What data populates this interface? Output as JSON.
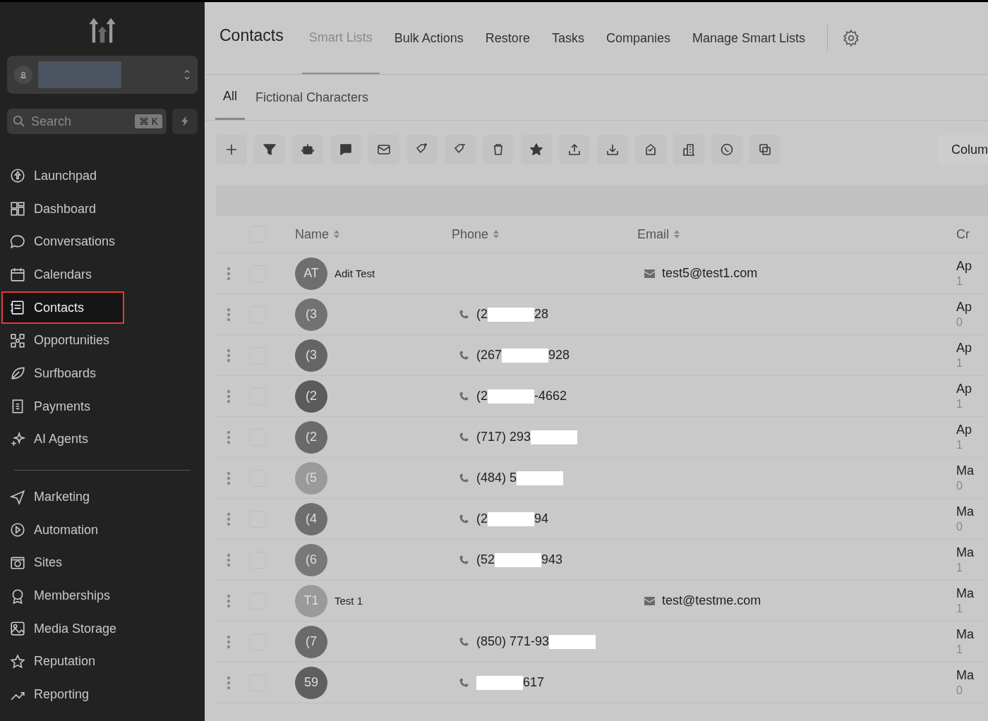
{
  "sidebar": {
    "search": {
      "placeholder": "Search",
      "shortcut": "⌘ K"
    },
    "items": [
      {
        "label": "Launchpad",
        "selected": false
      },
      {
        "label": "Dashboard",
        "selected": false
      },
      {
        "label": "Conversations",
        "selected": false
      },
      {
        "label": "Calendars",
        "selected": false
      },
      {
        "label": "Contacts",
        "selected": true
      },
      {
        "label": "Opportunities",
        "selected": false
      },
      {
        "label": "Surfboards",
        "selected": false
      },
      {
        "label": "Payments",
        "selected": false
      },
      {
        "label": "AI Agents",
        "selected": false
      }
    ],
    "items_2": [
      {
        "label": "Marketing",
        "selected": false
      },
      {
        "label": "Automation",
        "selected": false
      },
      {
        "label": "Sites",
        "selected": false
      },
      {
        "label": "Memberships",
        "selected": false
      },
      {
        "label": "Media Storage",
        "selected": false
      },
      {
        "label": "Reputation",
        "selected": false
      },
      {
        "label": "Reporting",
        "selected": false
      }
    ]
  },
  "header": {
    "title": "Contacts",
    "tabs": [
      {
        "label": "Smart Lists",
        "selected": true
      },
      {
        "label": "Bulk Actions",
        "selected": false
      },
      {
        "label": "Restore",
        "selected": false
      },
      {
        "label": "Tasks",
        "selected": false
      },
      {
        "label": "Companies",
        "selected": false
      },
      {
        "label": "Manage Smart Lists",
        "selected": false
      }
    ]
  },
  "list_tabs": [
    {
      "label": "All",
      "selected": true
    },
    {
      "label": "Fictional Characters",
      "selected": false
    }
  ],
  "columns_button": "Colum",
  "table": {
    "columns": [
      "Name",
      "Phone",
      "Email",
      "Cr"
    ],
    "select_all_checked": false,
    "rows": [
      {
        "initials": "AT",
        "color": "#6e6e6e",
        "name": "Adit Test",
        "phone_start": "",
        "phone_end": "",
        "email": "test5@test1.com",
        "created": "Ap",
        "created_2": "1",
        "checked": false
      },
      {
        "initials": "(3",
        "color": "#727272",
        "name": "",
        "phone_start": "(2",
        "phone_end": "28",
        "email": "",
        "created": "Ap",
        "created_2": "0",
        "checked": false
      },
      {
        "initials": "(3",
        "color": "#656565",
        "name": "",
        "phone_start": "(267",
        "phone_end": "928",
        "email": "",
        "created": "Ap",
        "created_2": "1",
        "checked": false
      },
      {
        "initials": "(2",
        "color": "#5b5b5b",
        "name": "",
        "phone_start": "(2",
        "phone_end": "-4662",
        "email": "",
        "created": "Ap",
        "created_2": "1",
        "checked": false
      },
      {
        "initials": "(2",
        "color": "#6a6a6a",
        "name": "",
        "phone_start": "(717) 293",
        "phone_end": "",
        "email": "",
        "created": "Ap",
        "created_2": "1",
        "checked": false
      },
      {
        "initials": "(5",
        "color": "#9a9a9a",
        "name": "",
        "phone_start": "(484) 5",
        "phone_end": "",
        "email": "",
        "created": "Ma",
        "created_2": "0",
        "checked": false
      },
      {
        "initials": "(4",
        "color": "#6e6e6e",
        "name": "",
        "phone_start": "(2",
        "phone_end": "94",
        "email": "",
        "created": "Ma",
        "created_2": "0",
        "checked": false
      },
      {
        "initials": "(6",
        "color": "#787878",
        "name": "",
        "phone_start": "(52",
        "phone_end": "943",
        "email": "",
        "created": "Ma",
        "created_2": "1",
        "checked": false
      },
      {
        "initials": "T1",
        "color": "#9a9a9a",
        "name": "Test 1",
        "phone_start": "",
        "phone_end": "",
        "email": "test@testme.com",
        "created": "Ma",
        "created_2": "1",
        "checked": false
      },
      {
        "initials": "(7",
        "color": "#6a6a6a",
        "name": "",
        "phone_start": "(850) 771-93",
        "phone_end": "",
        "email": "",
        "created": "Ma",
        "created_2": "1",
        "checked": false
      },
      {
        "initials": "59",
        "color": "#5f5f5f",
        "name": "",
        "phone_start": "",
        "phone_end": "617",
        "email": "",
        "created": "Ma",
        "created_2": "0",
        "checked": false
      }
    ]
  }
}
